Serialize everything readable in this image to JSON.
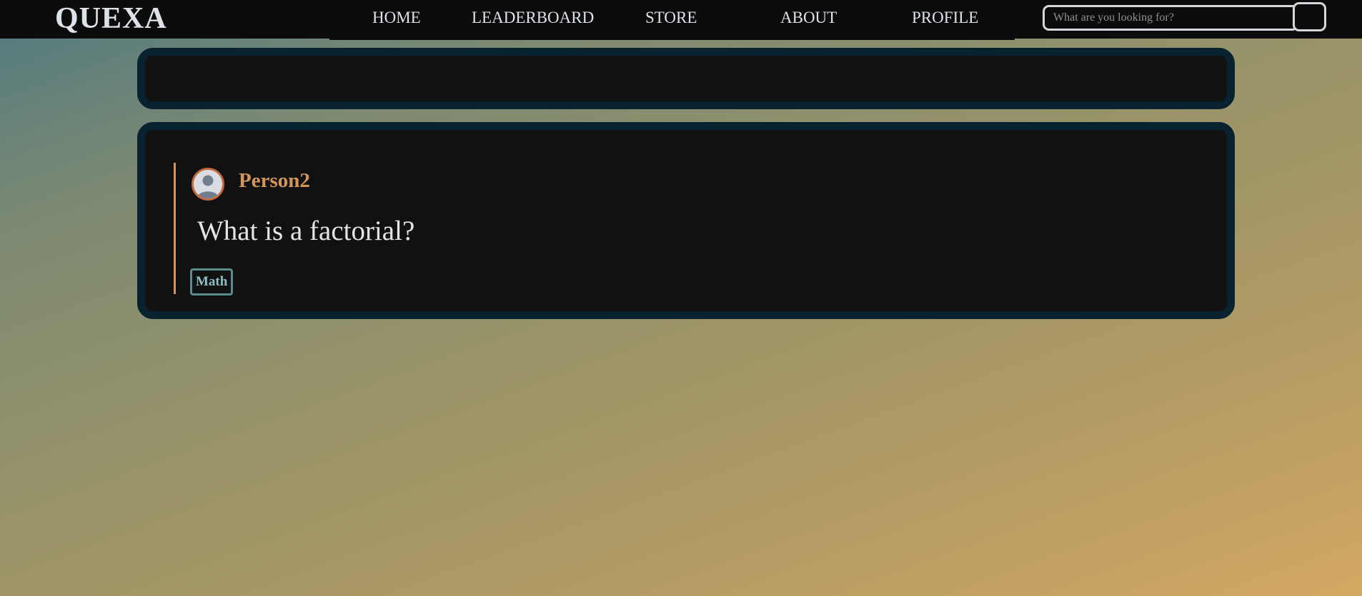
{
  "header": {
    "logo": "QUEXA",
    "nav": [
      {
        "label": "HOME"
      },
      {
        "label": "LEADERBOARD"
      },
      {
        "label": "STORE"
      },
      {
        "label": "ABOUT"
      },
      {
        "label": "PROFILE"
      }
    ],
    "search": {
      "placeholder": "What are you looking for?",
      "value": ""
    }
  },
  "post": {
    "author": "Person2",
    "question": "What is a factorial?",
    "tags": [
      {
        "label": "Math"
      }
    ]
  },
  "colors": {
    "accent": "#d4955a",
    "panel_border": "#082230",
    "tag_border": "#5a8a8a"
  }
}
